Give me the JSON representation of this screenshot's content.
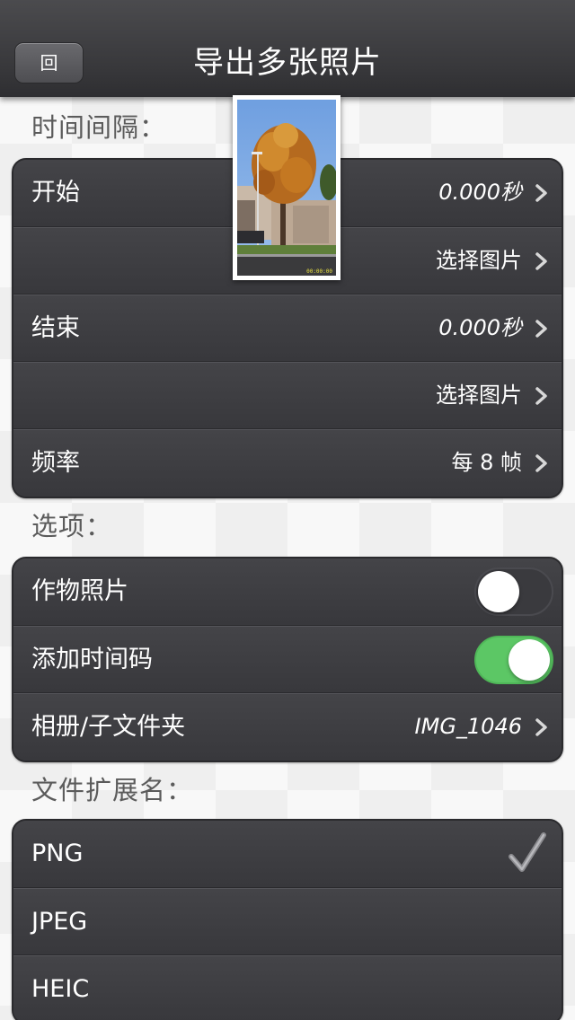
{
  "navbar": {
    "back_label": "回",
    "title": "导出多张照片"
  },
  "sections": {
    "interval_header": "时间间隔：",
    "options_header": "选项：",
    "extension_header": "文件扩展名："
  },
  "interval": {
    "start_label": "开始",
    "start_value": "0.000秒",
    "start_pick": "选择图片",
    "end_label": "结束",
    "end_value": "0.000秒",
    "end_pick": "选择图片",
    "rate_label": "频率",
    "rate_value": "每 8 帧"
  },
  "options": {
    "crop_label": "作物照片",
    "crop_enabled": false,
    "timecode_label": "添加时间码",
    "timecode_enabled": true,
    "album_label": "相册/子文件夹",
    "album_value": "IMG_1046"
  },
  "extensions": {
    "items": [
      "PNG",
      "JPEG",
      "HEIC"
    ],
    "selected": "PNG"
  },
  "thumbnail": {
    "icon": "tree-photo-thumbnail",
    "timestamp": "00:00:00"
  },
  "colors": {
    "toggle_on": "#5cc765",
    "row_bg": "#3d3d41"
  }
}
